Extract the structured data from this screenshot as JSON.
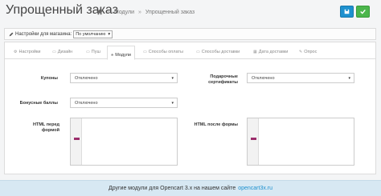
{
  "header": {
    "title": "Упрощенный заказ",
    "breadcrumb": [
      "Модули",
      "Упрощенный заказ"
    ],
    "save_icon": "save-icon",
    "ok_icon": "check-icon"
  },
  "store_bar": {
    "label": "Настройки для магазина:",
    "selected": "По умолчанию"
  },
  "tabs": [
    {
      "label": "Настройки",
      "icon": "gear-icon"
    },
    {
      "label": "Дизайн",
      "icon": "monitor-icon"
    },
    {
      "label": "Пуш",
      "icon": "bell-icon"
    },
    {
      "label": "Модули",
      "icon": "puzzle-icon"
    },
    {
      "label": "Способы оплаты",
      "icon": "card-icon"
    },
    {
      "label": "Способы доставки",
      "icon": "truck-icon"
    },
    {
      "label": "Дата доставки",
      "icon": "calendar-icon"
    },
    {
      "label": "Опрос",
      "icon": "pencil-icon"
    }
  ],
  "fields": {
    "coupons_label": "Купоны",
    "coupons_value": "Отключено",
    "gift_label": "Подарочные сертификаты",
    "gift_value": "Отключено",
    "bonus_label": "Бонусные баллы",
    "bonus_value": "Отключено",
    "html_before_label": "HTML перед формой",
    "html_after_label": "HTML после формы"
  },
  "footer": {
    "text": "Другие модули для Opencart 3.x на нашем сайте",
    "link": "opencart3x.ru"
  },
  "colors": {
    "primary": "#1e91cf",
    "success": "#4cb64c",
    "footer_bg": "#d7e8f3"
  }
}
